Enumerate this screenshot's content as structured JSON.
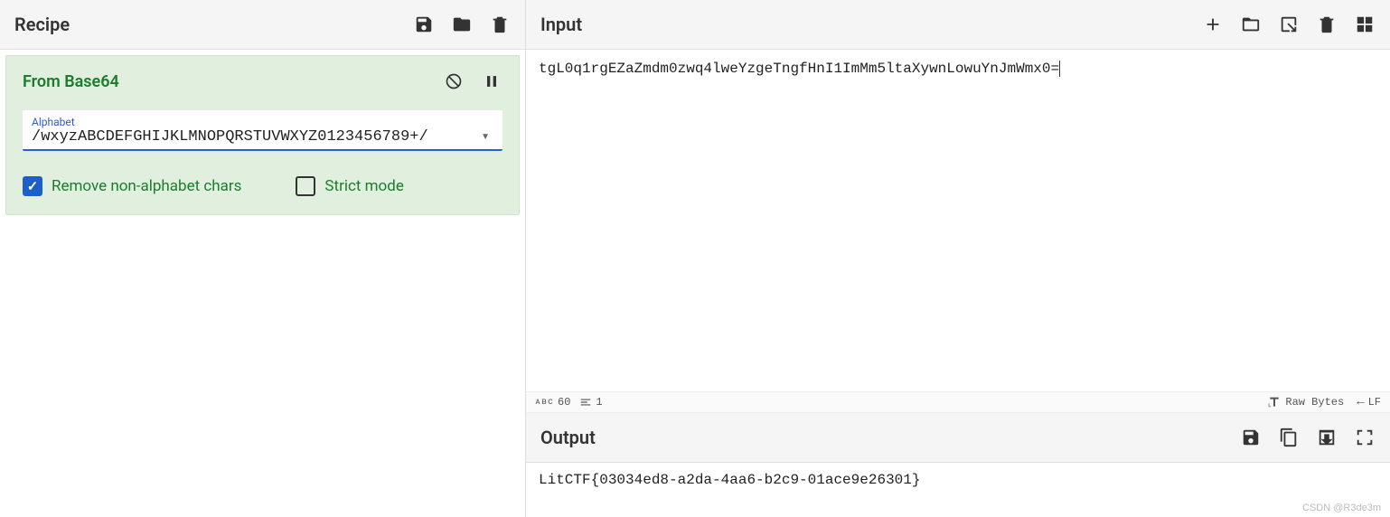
{
  "recipe": {
    "title": "Recipe",
    "operation": {
      "name": "From Base64",
      "alphabet_label": "Alphabet",
      "alphabet_value": "/wxyzABCDEFGHIJKLMNOPQRSTUVWXYZ0123456789+/",
      "remove_non_alpha": {
        "label": "Remove non-alphabet chars",
        "checked": true
      },
      "strict_mode": {
        "label": "Strict mode",
        "checked": false
      }
    }
  },
  "input": {
    "title": "Input",
    "text": "tgL0q1rgEZaZmdm0zwq4lweYzgeTngfHnI1ImMm5ltaXywnLowuYnJmWmx0="
  },
  "status": {
    "abc": "ᴀʙᴄ",
    "chars": "60",
    "lines": "1",
    "raw_bytes": "Raw Bytes",
    "line_ending": "LF"
  },
  "output": {
    "title": "Output",
    "text": "LitCTF{03034ed8-a2da-4aa6-b2c9-01ace9e26301}"
  },
  "watermark": "CSDN @R3de3m"
}
